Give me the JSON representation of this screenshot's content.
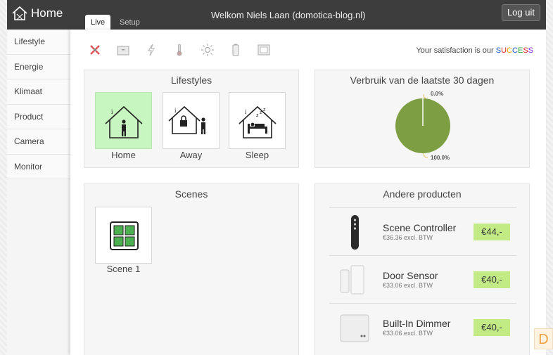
{
  "header": {
    "home_label": "Home",
    "welcome": "Welkom Niels Laan (domotica-blog.nl)",
    "logout_label": "Log uit",
    "tabs": [
      {
        "label": "Live"
      },
      {
        "label": "Setup"
      }
    ]
  },
  "sidebar": {
    "items": [
      {
        "label": "Lifestyle"
      },
      {
        "label": "Energie"
      },
      {
        "label": "Klimaat"
      },
      {
        "label": "Product"
      },
      {
        "label": "Camera"
      },
      {
        "label": "Monitor"
      }
    ]
  },
  "toolbar_icons": [
    "network-off-icon",
    "device-icon",
    "power-icon",
    "thermometer-icon",
    "sun-icon",
    "battery-icon",
    "camera-film-icon"
  ],
  "satisfaction": {
    "prefix": "Your satisfaction is our ",
    "word": "SUCCESS",
    "letter_colors": [
      "#1a57c8",
      "#d9251d",
      "#f0a300",
      "#1a57c8",
      "#2e9e3a",
      "#d9251d",
      "#8a2be2"
    ]
  },
  "lifestyles": {
    "title": "Lifestyles",
    "items": [
      {
        "label": "Home",
        "active": true
      },
      {
        "label": "Away",
        "active": false
      },
      {
        "label": "Sleep",
        "active": false
      }
    ]
  },
  "verbruik": {
    "title": "Verbruik van de laatste 30 dagen",
    "chart_data": {
      "type": "pie",
      "slices": [
        {
          "label": "0.0%",
          "value": 0.0
        },
        {
          "label": "100.0%",
          "value": 100.0
        }
      ],
      "colors": [
        "#cccccc",
        "#7d9e42"
      ]
    }
  },
  "scenes": {
    "title": "Scenes",
    "items": [
      {
        "label": "Scene 1"
      }
    ]
  },
  "andere": {
    "title": "Andere producten",
    "products": [
      {
        "name": "Scene Controller",
        "sub": "€36.36 excl. BTW",
        "price": "€44,-"
      },
      {
        "name": "Door Sensor",
        "sub": "€33.06 excl. BTW",
        "price": "€40,-"
      },
      {
        "name": "Built-In Dimmer",
        "sub": "€33.06 excl. BTW",
        "price": "€40,-"
      }
    ]
  },
  "corner_badge": "D"
}
